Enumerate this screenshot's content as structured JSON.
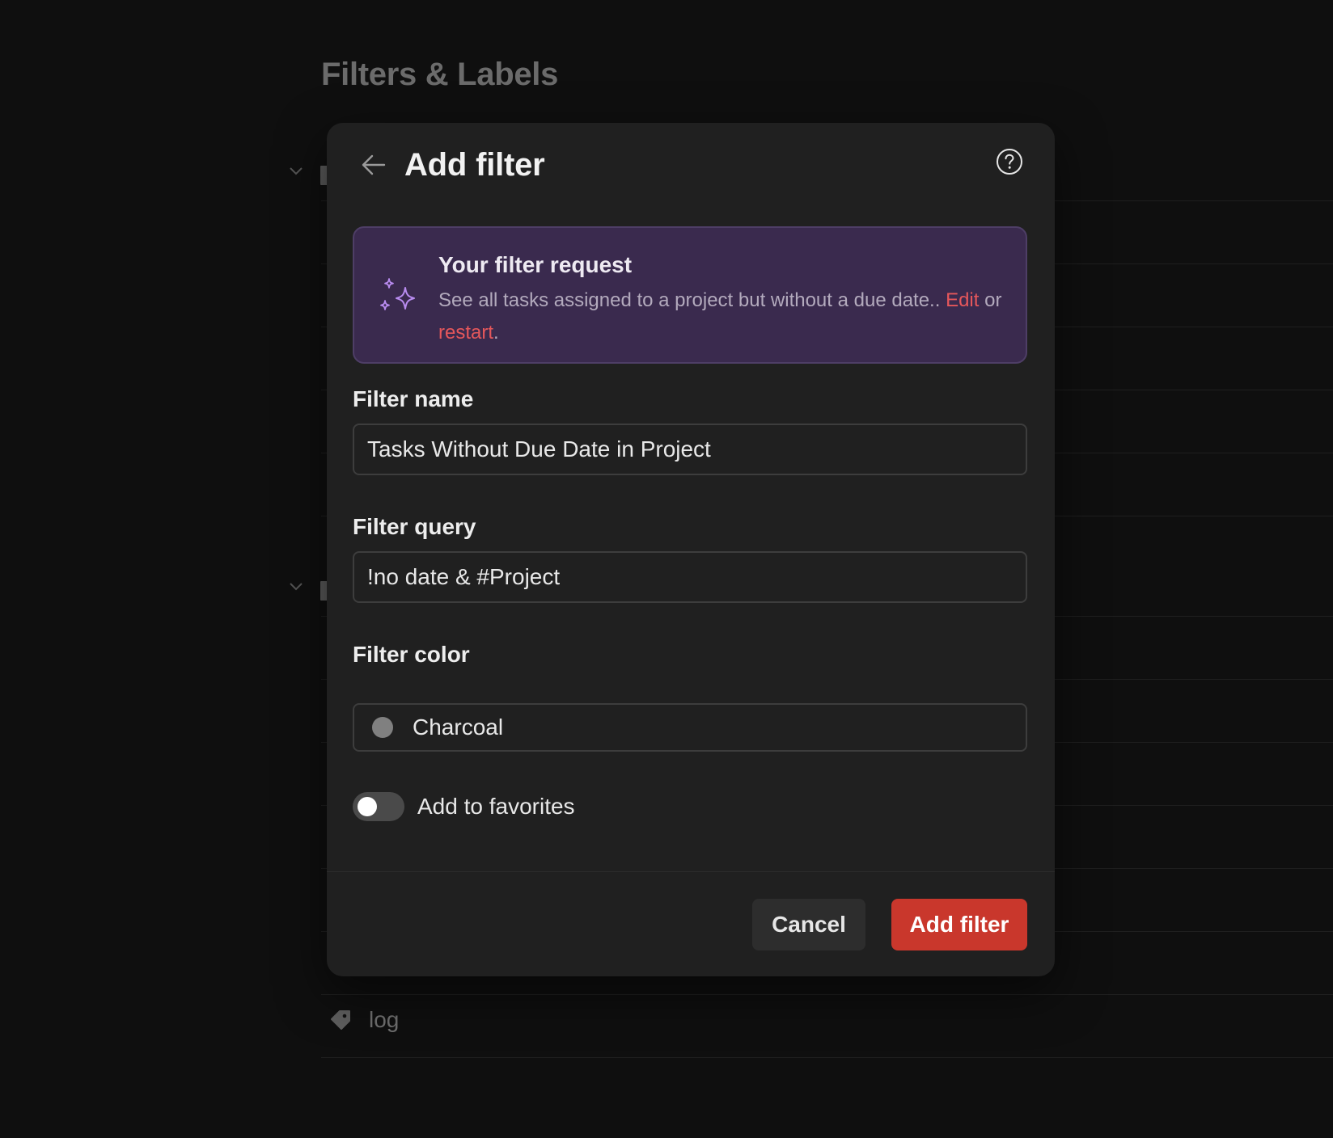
{
  "background": {
    "title": "Filters & Labels",
    "label_row": {
      "name": "log"
    }
  },
  "dialog": {
    "title": "Add filter",
    "request": {
      "title": "Your filter request",
      "text": "See all tasks assigned to a project but without a due date..",
      "edit_link": "Edit",
      "connector": "or",
      "restart_link": "restart",
      "end_punct": "."
    },
    "fields": {
      "name": {
        "label": "Filter name",
        "value": "Tasks Without Due Date in Project"
      },
      "query": {
        "label": "Filter query",
        "value": "!no date & #Project"
      },
      "color": {
        "label": "Filter color",
        "value": "Charcoal",
        "swatch": "#808080"
      }
    },
    "favorites": {
      "label": "Add to favorites",
      "enabled": false
    },
    "buttons": {
      "cancel": "Cancel",
      "submit": "Add filter"
    }
  },
  "colors": {
    "accent": "#c9372c",
    "link": "#e5575b",
    "request_bg": "#3a2a4e",
    "sparkle": "#b98cf0"
  }
}
